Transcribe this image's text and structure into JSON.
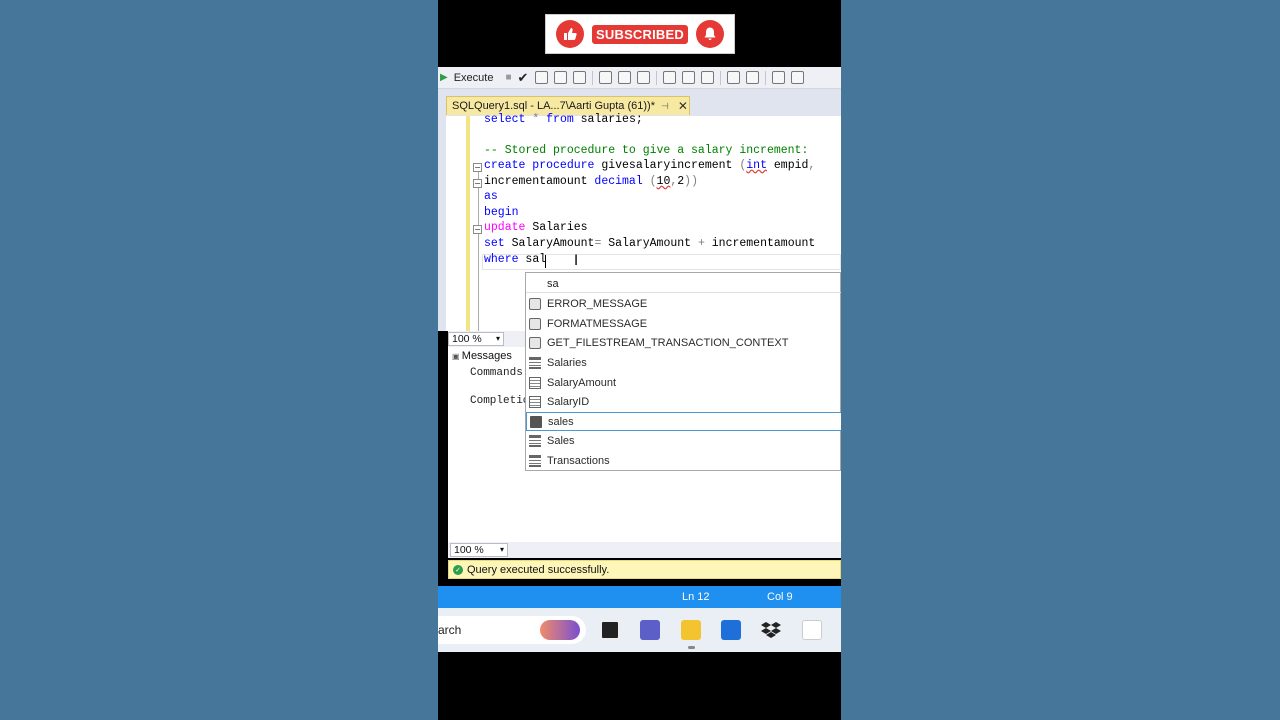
{
  "banner": {
    "subscribe_label": "SUBSCRIBED",
    "icons": [
      "thumbs-up-icon",
      "bell-icon"
    ]
  },
  "toolbar": {
    "execute_label": "Execute"
  },
  "tab": {
    "title": "SQLQuery1.sql - LA...7\\Aarti Gupta (61))*",
    "pin": "⊣",
    "close": "✕"
  },
  "editor": {
    "l1": {
      "a": "select",
      "b": " * ",
      "c": "from",
      "d": " salaries;"
    },
    "l2": "-- Stored procedure to give a salary increment:",
    "l3": {
      "a": "create procedure",
      "b": " givesalaryincrement ",
      "c": "(",
      "d": "int",
      "e": " empid",
      "f": ","
    },
    "l4": {
      "a": "incrementamount ",
      "b": "decimal",
      "c": " (",
      "d": "10",
      "e": ",",
      "f": "2",
      "g": "))"
    },
    "l5": "as",
    "l6": "begin",
    "l7": {
      "a": "update",
      "b": " Salaries"
    },
    "l8": {
      "a": "set",
      "b": " SalaryAmount",
      "c": "=",
      "d": " SalaryAmount ",
      "e": "+",
      "f": " incrementamount"
    },
    "l9": {
      "a": "where",
      "b": " sal"
    }
  },
  "autocomplete": {
    "filter": "sa",
    "items": [
      {
        "label": "ERROR_MESSAGE",
        "icon": "function-icon"
      },
      {
        "label": "FORMATMESSAGE",
        "icon": "function-icon"
      },
      {
        "label": "GET_FILESTREAM_TRANSACTION_CONTEXT",
        "icon": "function-icon"
      },
      {
        "label": "Salaries",
        "icon": "table-icon"
      },
      {
        "label": "SalaryAmount",
        "icon": "column-icon"
      },
      {
        "label": "SalaryID",
        "icon": "column-icon"
      },
      {
        "label": "sales",
        "icon": "calculator-icon",
        "selected": true
      },
      {
        "label": "Sales",
        "icon": "table-icon"
      },
      {
        "label": "Transactions",
        "icon": "table-icon"
      }
    ]
  },
  "zoom": {
    "editor": "100 %",
    "results": "100 %"
  },
  "results": {
    "tab": "Messages",
    "line1": "Commands",
    "line2": "Completic"
  },
  "status": {
    "query": "Query executed successfully.",
    "ln": "Ln 12",
    "col": "Col 9"
  },
  "taskbar": {
    "search": "arch"
  }
}
